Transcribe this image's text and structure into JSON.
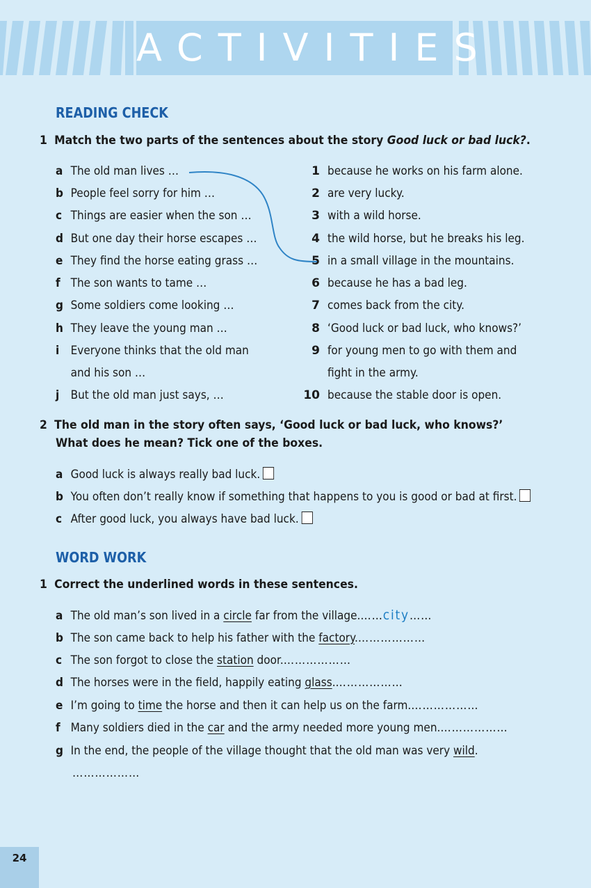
{
  "banner": {
    "title": "ACTIVITIES"
  },
  "reading_check": {
    "heading": "READING CHECK",
    "q1": {
      "number": "1",
      "prompt": "Match the two parts of the sentences about the story ",
      "story_title": "Good luck or bad luck?",
      "prompt_end": ".",
      "left": [
        {
          "letter": "a",
          "text": "The old man lives …"
        },
        {
          "letter": "b",
          "text": "People feel sorry for him …"
        },
        {
          "letter": "c",
          "text": "Things are easier when the son …"
        },
        {
          "letter": "d",
          "text": "But one day their horse escapes …"
        },
        {
          "letter": "e",
          "text": "They find the horse eating grass …"
        },
        {
          "letter": "f",
          "text": "The son wants to tame …"
        },
        {
          "letter": "g",
          "text": "Some soldiers come looking …"
        },
        {
          "letter": "h",
          "text": "They leave the young man …"
        },
        {
          "letter": "i",
          "text": "Everyone thinks that the old man"
        },
        {
          "letter": "",
          "text": "and his son …"
        },
        {
          "letter": "j",
          "text": "But the old man just says, …"
        }
      ],
      "right": [
        {
          "number": "1",
          "text": "because he works on his farm alone."
        },
        {
          "number": "2",
          "text": "are very lucky."
        },
        {
          "number": "3",
          "text": "with a wild horse."
        },
        {
          "number": "4",
          "text": "the wild horse, but he breaks his leg."
        },
        {
          "number": "5",
          "text": "in a small village in the mountains."
        },
        {
          "number": "6",
          "text": "because he has a bad leg."
        },
        {
          "number": "7",
          "text": "comes back from the city."
        },
        {
          "number": "8",
          "text": "‘Good luck or bad luck, who knows?’"
        },
        {
          "number": "9",
          "text": "for young men to go with them and"
        },
        {
          "number": "",
          "text": "fight in the army."
        },
        {
          "number": "10",
          "text": "because the stable door is open."
        }
      ]
    },
    "q2": {
      "number": "2",
      "line1": "The old man in the story often says, ‘Good luck or bad luck, who knows?’",
      "line2": "What does he mean? Tick one of the boxes.",
      "options": [
        {
          "letter": "a",
          "text": "Good luck is always really bad luck."
        },
        {
          "letter": "b",
          "text": "You often don’t really know if something that happens to you is good or bad at first."
        },
        {
          "letter": "c",
          "text": "After good luck, you always have bad luck."
        }
      ]
    }
  },
  "word_work": {
    "heading": "WORD WORK",
    "q1": {
      "number": "1",
      "prompt": "Correct the underlined words in these sentences.",
      "items": [
        {
          "letter": "a",
          "before": "The old man’s son lived in a ",
          "underlined": "circle",
          "after": " far from the village.",
          "answer": "city"
        },
        {
          "letter": "b",
          "before": "The son came back to help his father with the ",
          "underlined": "factory",
          "after": ".",
          "answer": ""
        },
        {
          "letter": "c",
          "before": "The son forgot to close the ",
          "underlined": "station",
          "after": " door.",
          "answer": ""
        },
        {
          "letter": "d",
          "before": "The horses were in the field, happily eating ",
          "underlined": "glass",
          "after": ".",
          "answer": ""
        },
        {
          "letter": "e",
          "before": "I’m going to ",
          "underlined": "time",
          "after": " the horse and then it can help us on the farm.",
          "answer": ""
        },
        {
          "letter": "f",
          "before": "Many soldiers died in the ",
          "underlined": "car",
          "after": " and the army needed more young men.",
          "answer": ""
        },
        {
          "letter": "g",
          "before": "In the end, the people of the village thought that the old man was very ",
          "underlined": "wild",
          "after": ".",
          "answer": ""
        }
      ],
      "blank": "………………"
    }
  },
  "page_number": "24",
  "colors": {
    "background": "#d7ecf8",
    "banner": "#aed6ef",
    "heading": "#1d5fa8",
    "handwriting": "#1f7fc4"
  }
}
